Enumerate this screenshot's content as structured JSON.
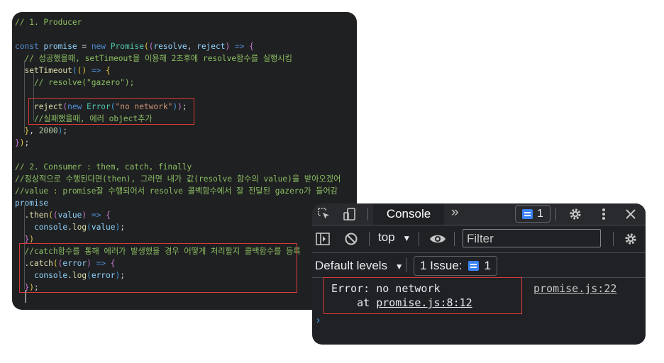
{
  "editor": {
    "lines": [
      [
        [
          "// 1. Producer",
          "cm"
        ]
      ],
      [],
      [
        [
          "const",
          "kw"
        ],
        [
          " ",
          "pn"
        ],
        [
          "promise",
          "var"
        ],
        [
          " = ",
          "pn"
        ],
        [
          "new",
          "kw"
        ],
        [
          " ",
          "pn"
        ],
        [
          "Promise",
          "cls"
        ],
        [
          "(",
          "br1"
        ],
        [
          "(",
          "br2"
        ],
        [
          "resolve",
          "var"
        ],
        [
          ", ",
          "pn"
        ],
        [
          "reject",
          "var"
        ],
        [
          ")",
          "br2"
        ],
        [
          " => ",
          "kw"
        ],
        [
          "{",
          "br2"
        ]
      ],
      [
        [
          "  // 성공했을때, setTimeout을 이용해 2초후에 resolve함수를 실행시킴",
          "cm"
        ]
      ],
      [
        [
          "  ",
          "pn"
        ],
        [
          "setTimeout",
          "fn"
        ],
        [
          "(",
          "br3"
        ],
        [
          "()",
          "br1"
        ],
        [
          " => ",
          "kw"
        ],
        [
          "{",
          "br1"
        ]
      ],
      [
        [
          "    // resolve(\"gazero\");",
          "cm"
        ]
      ],
      [],
      [
        [
          "    ",
          "pn"
        ],
        [
          "reject",
          "fn"
        ],
        [
          "(",
          "br2"
        ],
        [
          "new",
          "kw"
        ],
        [
          " ",
          "pn"
        ],
        [
          "Error",
          "cls"
        ],
        [
          "(",
          "br3"
        ],
        [
          "\"no network\"",
          "str"
        ],
        [
          ")",
          "br3"
        ],
        [
          ")",
          "br2"
        ],
        [
          ";",
          "pn"
        ]
      ],
      [
        [
          "    //실패했을때, 에러 object추가",
          "cm"
        ]
      ],
      [
        [
          "  ",
          "pn"
        ],
        [
          "}",
          "br1"
        ],
        [
          ", ",
          "pn"
        ],
        [
          "2000",
          "num"
        ],
        [
          ")",
          "br3"
        ],
        [
          ";",
          "pn"
        ]
      ],
      [
        [
          "}",
          "br2"
        ],
        [
          ")",
          "br1"
        ],
        [
          ";",
          "pn"
        ]
      ],
      [],
      [
        [
          "// 2. Consumer : them, catch, finally",
          "cm"
        ]
      ],
      [
        [
          "//정상적으로 수행된다면(then), 그러면 내가 값(resolve 함수의 value)을 받아오겠어",
          "cm"
        ]
      ],
      [
        [
          "//value : promise잘 수행되어서 resolve 콜백함수에서 잘 전달된 gazero가 들어감",
          "cm"
        ]
      ],
      [
        [
          "promise",
          "var"
        ]
      ],
      [
        [
          "  .",
          "pn"
        ],
        [
          "then",
          "fn"
        ],
        [
          "(",
          "br1"
        ],
        [
          "(",
          "br2"
        ],
        [
          "value",
          "var"
        ],
        [
          ")",
          "br2"
        ],
        [
          " => ",
          "kw"
        ],
        [
          "{",
          "br2"
        ]
      ],
      [
        [
          "    ",
          "pn"
        ],
        [
          "console",
          "var"
        ],
        [
          ".",
          "pn"
        ],
        [
          "log",
          "fn"
        ],
        [
          "(",
          "br3"
        ],
        [
          "value",
          "var"
        ],
        [
          ")",
          "br3"
        ],
        [
          ";",
          "pn"
        ]
      ],
      [
        [
          "  ",
          "pn"
        ],
        [
          "}",
          "br2"
        ],
        [
          ")",
          "br1"
        ]
      ],
      [
        [
          "  //catch함수를 통해 에러가 발생했을 경우 어떻게 처리할지 콜백함수를 등록",
          "cm"
        ]
      ],
      [
        [
          "  .",
          "pn"
        ],
        [
          "catch",
          "fn"
        ],
        [
          "(",
          "br1"
        ],
        [
          "(",
          "br2"
        ],
        [
          "error",
          "var"
        ],
        [
          ")",
          "br2"
        ],
        [
          " => ",
          "kw"
        ],
        [
          "{",
          "br2"
        ]
      ],
      [
        [
          "    ",
          "pn"
        ],
        [
          "console",
          "var"
        ],
        [
          ".",
          "pn"
        ],
        [
          "log",
          "fn"
        ],
        [
          "(",
          "br3"
        ],
        [
          "error",
          "var"
        ],
        [
          ")",
          "br3"
        ],
        [
          ";",
          "pn"
        ]
      ],
      [
        [
          "  ",
          "pn"
        ],
        [
          "}",
          "br2"
        ],
        [
          ")",
          "br1"
        ],
        [
          ";",
          "pn"
        ]
      ],
      []
    ]
  },
  "devtools": {
    "tab_label": "Console",
    "more_tabs": "»",
    "issue_badge_count": "1",
    "context": "top",
    "filter_placeholder": "Filter",
    "levels_label": "Default levels",
    "issue_label": "1 Issue:",
    "issue_count": "1",
    "message": {
      "line1": "Error: no network",
      "at_prefix": "    at ",
      "at_link": "promise.js:8:12",
      "source": "promise.js:22"
    },
    "prompt": "›"
  },
  "colors": {
    "highlight_box": "#d83a3a",
    "editor_bg": "#1f2021",
    "devtools_bg": "#202124",
    "accent_blue": "#3b82f6"
  }
}
